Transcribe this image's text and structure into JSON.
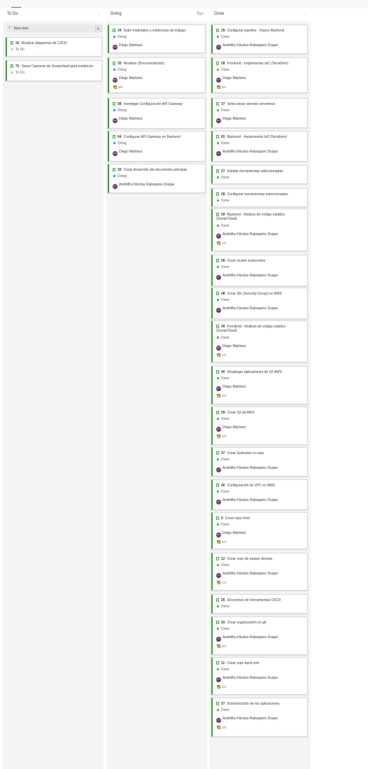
{
  "colors": {
    "card_accent": "#339933",
    "state_todo": "#b2b2b2",
    "state_doing": "#007acc",
    "state_done": "#339933",
    "avatar": "#5c2d62",
    "tab_accent": "#0078d4"
  },
  "columns": [
    {
      "title": "To Do",
      "chevron": "‹",
      "new_item_label": "New item",
      "cards": [
        {
          "id": "32",
          "title": "Realizar diagramas de CI/CD",
          "state": "To Do",
          "assignee": "",
          "tasks": ""
        },
        {
          "id": "70",
          "title": "Sacar Capturas de Sonarcloud para evidencia",
          "state": "To Do",
          "assignee": "",
          "tasks": ""
        }
      ]
    },
    {
      "title": "Doing",
      "extra": "Sys",
      "chevron": "",
      "cards": [
        {
          "id": "34",
          "title": "Subir materiales y evidencias de trabajo",
          "state": "Doing",
          "assignee": "Diego Martinez",
          "initials": "DM",
          "tasks": ""
        },
        {
          "id": "35",
          "title": "Readme (Documentación)",
          "state": "Doing",
          "assignee": "Diego Martinez",
          "initials": "DM",
          "tasks": "0/3"
        },
        {
          "id": "68",
          "title": "Investigar Configuración API Gateway",
          "state": "Doing",
          "assignee": "Diego Martinez",
          "initials": "DM",
          "tasks": ""
        },
        {
          "id": "64",
          "title": "Configurar API Gateway en Backend",
          "state": "Doing",
          "assignee": "Diego Martinez",
          "initials": "DM",
          "tasks": ""
        },
        {
          "id": "36",
          "title": "Crear desarrollo del documento principal",
          "state": "Doing",
          "assignee": "Andriithu Nicolas Rabaquino Duque",
          "initials": "AN",
          "tasks": ""
        }
      ]
    },
    {
      "title": "Done",
      "chevron": "‹",
      "cards": [
        {
          "id": "29",
          "title": "Configurar pipeline - Repos Backend",
          "state": "Done",
          "assignee": "Andriithu Nicolas Rabaquino Duque",
          "initials": "AN",
          "tasks": ""
        },
        {
          "id": "58",
          "title": "Frontend - Implementar IaC (Terraform)",
          "state": "Done",
          "assignee": "Diego Martinez",
          "initials": "DM",
          "tasks": "0/1"
        },
        {
          "id": "37",
          "title": "Seleccionar servicio serverless",
          "state": "Done",
          "assignee": "Diego Martinez",
          "initials": "DM",
          "tasks": ""
        },
        {
          "id": "65",
          "title": "Backend - Implementar IaC(Terraform)",
          "state": "Done",
          "assignee": "Andriithu Nicolas Rabaquino Duque",
          "initials": "AN",
          "tasks": ""
        },
        {
          "id": "27",
          "title": "Instalar herramientas seleccionadas",
          "state": "Done",
          "assignee": "",
          "tasks": ""
        },
        {
          "id": "28",
          "title": "Configurar herramientas seleccionadas",
          "state": "Done",
          "assignee": "",
          "tasks": ""
        },
        {
          "id": "59",
          "title": "Backend - Análisis de código estático (SonarCloud)",
          "state": "Done",
          "assignee": "Andriithu Nicolas Rabaquino Duque",
          "initials": "AN",
          "tasks": "2/2"
        },
        {
          "id": "38",
          "title": "Crear cluster kubernetes",
          "state": "Done",
          "assignee": "Andriithu Nicolas Rabaquino Duque",
          "initials": "AN",
          "tasks": ""
        },
        {
          "id": "48",
          "title": "Crear SG (Security Group) en AWS",
          "state": "Done",
          "assignee": "Andriithu Nicolas Rabaquino Duque",
          "initials": "AN",
          "tasks": ""
        },
        {
          "id": "49",
          "title": "FrontEnd - Análisis de código estático (SonarCloud)",
          "state": "Done",
          "assignee": "Diego Martinez",
          "initials": "DM",
          "tasks": "2/2"
        },
        {
          "id": "40",
          "title": "Desplegar aplicaciones de S3 AWS",
          "state": "Done",
          "assignee": "Diego Martinez",
          "initials": "DM",
          "tasks": "3/3"
        },
        {
          "id": "39",
          "title": "Crear S3 de AWS",
          "state": "Done",
          "assignee": "Diego Martinez",
          "initials": "DM",
          "tasks": "3/3"
        },
        {
          "id": "47",
          "title": "Crear Subredes en aws",
          "state": "Done",
          "assignee": "Andriithu Nicolas Rabaquino Duque",
          "initials": "AN",
          "tasks": ""
        },
        {
          "id": "46",
          "title": "Configuración de VPC en AWS",
          "state": "Done",
          "assignee": "Andriithu Nicolas Rabaquino Duque",
          "initials": "AN",
          "tasks": ""
        },
        {
          "id": "9",
          "title": "Crear repo front",
          "state": "Done",
          "assignee": "Diego Martinez",
          "initials": "DM",
          "tasks": "4/4"
        },
        {
          "id": "12",
          "title": "Crear repo de equipo devops",
          "state": "Done",
          "assignee": "Andriithu Nicolas Rabaquino Duque",
          "initials": "AN",
          "tasks": "4/4"
        },
        {
          "id": "26",
          "title": "Elecciones de herramientas CI/CD",
          "state": "Done",
          "assignee": "",
          "tasks": ""
        },
        {
          "id": "43",
          "title": "Crear organización en git",
          "state": "Done",
          "assignee": "Andriithu Nicolas Rabaquino Duque",
          "initials": "AN",
          "tasks": "0/1"
        },
        {
          "id": "11",
          "title": "Crear repo back-end",
          "state": "Done",
          "assignee": "Andriithu Nicolas Rabaquino Duque",
          "initials": "AN",
          "tasks": "4/4"
        },
        {
          "id": "37",
          "title": "Dockerización de las aplicaciones",
          "state": "Done",
          "assignee": "Andriithu Nicolas Rabaquino Duque",
          "initials": "AN",
          "tasks": "2/2"
        }
      ]
    }
  ]
}
